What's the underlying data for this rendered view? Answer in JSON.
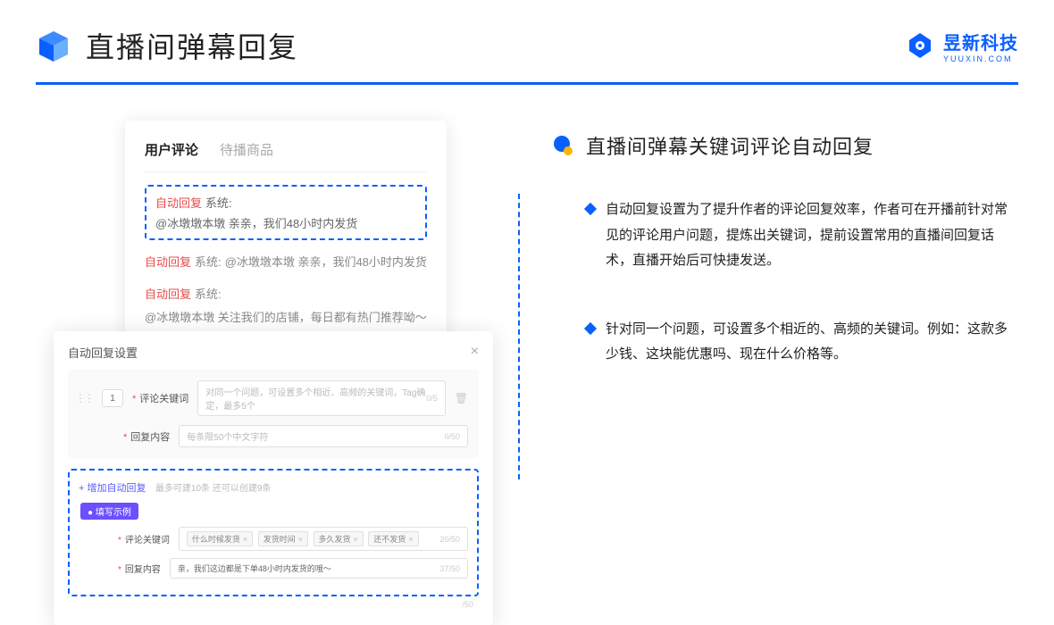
{
  "header": {
    "title": "直播间弹幕回复",
    "brand": "昱新科技",
    "brand_sub": "YUUXIN.COM"
  },
  "comments_card": {
    "tab_active": "用户评论",
    "tab_inactive": "待播商品",
    "highlight_tag": "自动回复",
    "highlight_sys": "系统:",
    "highlight_text": "@冰墩墩本墩 亲亲，我们48小时内发货",
    "line2_tag": "自动回复",
    "line2_sys": "系统:",
    "line2_text": "@冰墩墩本墩 亲亲，我们48小时内发货",
    "line3_tag": "自动回复",
    "line3_sys": "系统:",
    "line3_text": "@冰墩墩本墩 关注我们的店铺，每日都有热门推荐呦～"
  },
  "settings": {
    "title": "自动回复设置",
    "num": "1",
    "label_keyword": "评论关键词",
    "placeholder_keyword": "对同一个问题，可设置多个相近、高频的关键词，Tag确定，最多5个",
    "count_keyword": "0/5",
    "label_content": "回复内容",
    "placeholder_content": "每条限50个中文字符",
    "count_content": "0/50",
    "add_link": "+ 增加自动回复",
    "add_hint": "最多可建10条 还可以创建9条",
    "example_tag": "● 填写示例",
    "ex_label_kw": "评论关键词",
    "ex_tag1": "什么时候发货",
    "ex_tag2": "发货时间",
    "ex_tag3": "多久发货",
    "ex_tag4": "还不发货",
    "ex_kw_count": "20/50",
    "ex_label_ct": "回复内容",
    "ex_content": "亲，我们这边都是下单48小时内发货的哦～",
    "ex_ct_count": "37/50",
    "ex_bottom_count": "/50"
  },
  "right": {
    "sec_title": "直播间弹幕关键词评论自动回复",
    "bullet1": "自动回复设置为了提升作者的评论回复效率，作者可在开播前针对常见的评论用户问题，提炼出关键词，提前设置常用的直播间回复话术，直播开始后可快捷发送。",
    "bullet2": "针对同一个问题，可设置多个相近的、高频的关键词。例如：这款多少钱、这块能优惠吗、现在什么价格等。"
  }
}
